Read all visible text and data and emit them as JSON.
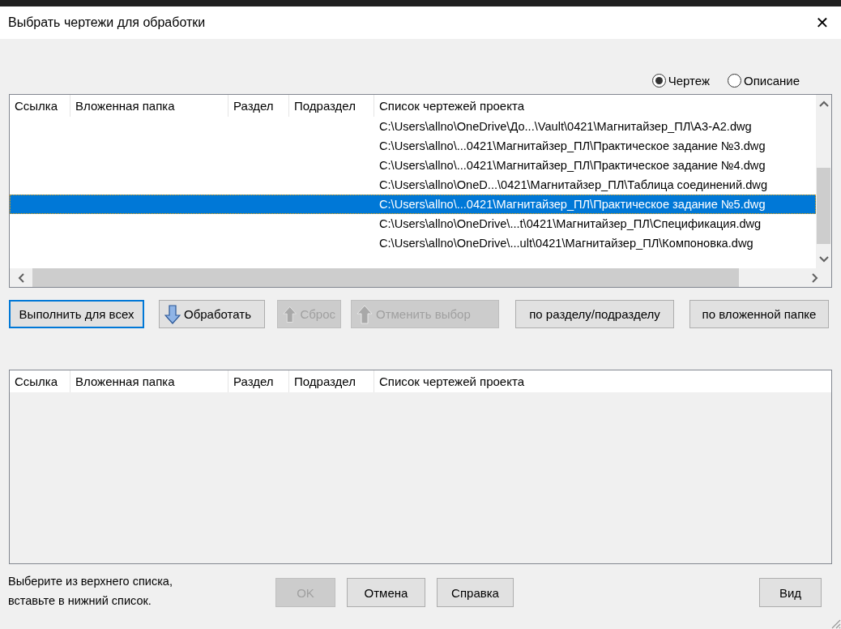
{
  "window": {
    "title": "Выбрать чертежи для обработки",
    "close": "✕"
  },
  "view_mode": [
    {
      "label": "Чертеж",
      "selected": true
    },
    {
      "label": "Описание",
      "selected": false
    }
  ],
  "upper_list": {
    "columns": [
      "Ссылка",
      "Вложенная папка",
      "Раздел",
      "Подраздел",
      "Список чертежей проекта"
    ],
    "rows": [
      {
        "path": "C:\\Users\\allno\\OneDrive\\До...\\Vault\\0421\\Магнитайзер_ПЛ\\А3-А2.dwg",
        "selected": false
      },
      {
        "path": "C:\\Users\\allno\\...0421\\Магнитайзер_ПЛ\\Практическое задание №3.dwg",
        "selected": false
      },
      {
        "path": "C:\\Users\\allno\\...0421\\Магнитайзер_ПЛ\\Практическое задание №4.dwg",
        "selected": false
      },
      {
        "path": "C:\\Users\\allno\\OneD...\\0421\\Магнитайзер_ПЛ\\Таблица соединений.dwg",
        "selected": false
      },
      {
        "path": "C:\\Users\\allno\\...0421\\Магнитайзер_ПЛ\\Практическое задание №5.dwg",
        "selected": true
      },
      {
        "path": "C:\\Users\\allno\\OneDrive\\...t\\0421\\Магнитайзер_ПЛ\\Спецификация.dwg",
        "selected": false
      },
      {
        "path": "C:\\Users\\allno\\OneDrive\\...ult\\0421\\Магнитайзер_ПЛ\\Компоновка.dwg",
        "selected": false
      }
    ]
  },
  "actions": [
    {
      "label": "Выполнить для всех",
      "kind": "plain",
      "disabled": false,
      "focused": true
    },
    {
      "label": "Обработать",
      "kind": "arrow-down",
      "disabled": false,
      "focused": false
    },
    {
      "label": "Сброс",
      "kind": "arrow-up",
      "disabled": true,
      "focused": false
    },
    {
      "label": "Отменить выбор",
      "kind": "arrow-up",
      "disabled": true,
      "focused": false
    },
    {
      "label": "по разделу/подразделу",
      "kind": "plain",
      "disabled": false,
      "focused": false
    },
    {
      "label": "по вложенной папке",
      "kind": "plain",
      "disabled": false,
      "focused": false
    }
  ],
  "lower_list": {
    "columns": [
      "Ссылка",
      "Вложенная папка",
      "Раздел",
      "Подраздел",
      "Список чертежей проекта"
    ]
  },
  "hint": "Выберите из верхнего списка,\nвставьте в нижний список.",
  "footer_buttons": [
    {
      "label": "OK",
      "disabled": true
    },
    {
      "label": "Отмена",
      "disabled": false
    },
    {
      "label": "Справка",
      "disabled": false
    }
  ],
  "view_button": "Вид"
}
